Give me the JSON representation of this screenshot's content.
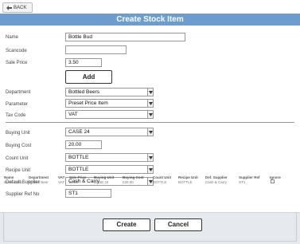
{
  "nav": {
    "back_label": "BACK"
  },
  "title": "Create Stock Item",
  "form": {
    "name": {
      "label": "Name",
      "value": "Bottle Bud"
    },
    "scancode": {
      "label": "Scancode",
      "value": ""
    },
    "sale_price": {
      "label": "Sale Price",
      "value": "3.50"
    },
    "add_label": "Add",
    "department": {
      "label": "Department",
      "value": "Bottled Beers"
    },
    "parameter": {
      "label": "Parameter",
      "value": "Preset Price Item"
    },
    "tax_code": {
      "label": "Tax Code",
      "value": "VAT"
    },
    "buying_unit": {
      "label": "Buying Unit",
      "value": "CASE 24"
    },
    "buying_cost": {
      "label": "Buying Cost",
      "value": "20.00"
    },
    "count_unit": {
      "label": "Count Unit",
      "value": "BOTTLE"
    },
    "recipe_unit": {
      "label": "Recipe Unit",
      "value": "BOTTLE"
    },
    "default_supplier": {
      "label": "Default Supplier",
      "value": "Cash & Carry"
    },
    "supplier_ref": {
      "label": "Supplier Ref No",
      "value": "ST1"
    }
  },
  "summary": {
    "headers": [
      "Name",
      "Department",
      "VAT",
      "Sale Price",
      "Buying Unit",
      "Buying Cost",
      "Count Unit",
      "Recipe Unit",
      "Def. Supplier",
      "Supplier Ref",
      "Ignore"
    ],
    "row": [
      "Bottle Stella",
      "Bottled Beer",
      "VAT",
      "£3.20",
      "CASE 24",
      "£20.00",
      "BOTTLE",
      "BOTTLE",
      "Cash & Carry",
      "ST1"
    ]
  },
  "footer": {
    "create_label": "Create",
    "cancel_label": "Cancel"
  },
  "colors": {
    "title_bar": "#6d9ccf",
    "footer_bg": "#e6e9ee"
  }
}
